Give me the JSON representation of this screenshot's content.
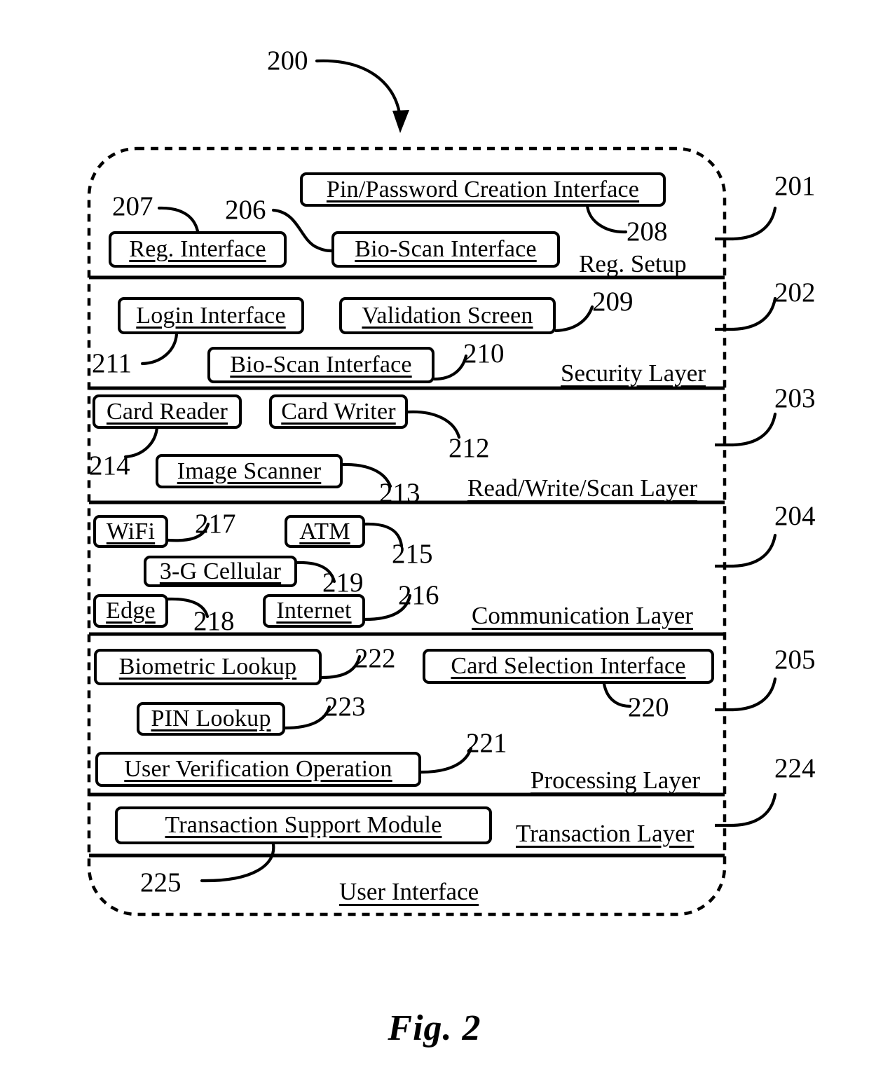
{
  "figure": {
    "caption": "Fig. 2",
    "system_ref": "200"
  },
  "diagram": {
    "type": "layered-block-diagram",
    "container_label": "User Interface",
    "container_ref": "200",
    "layers": [
      {
        "ref": "201",
        "caption": "Reg. Setup",
        "nodes": [
          {
            "ref": "208",
            "label": "Pin/Password Creation Interface"
          },
          {
            "ref": "207",
            "label": "Reg. Interface"
          },
          {
            "ref": "206",
            "label": "Bio-Scan Interface"
          }
        ]
      },
      {
        "ref": "202",
        "caption": "Security Layer",
        "nodes": [
          {
            "ref": "211",
            "label": "Login Interface"
          },
          {
            "ref": "209",
            "label": "Validation Screen"
          },
          {
            "ref": "210",
            "label": "Bio-Scan Interface"
          }
        ]
      },
      {
        "ref": "203",
        "caption": "Read/Write/Scan Layer",
        "nodes": [
          {
            "ref": "214",
            "label": "Card Reader"
          },
          {
            "ref": "212",
            "label": "Card Writer"
          },
          {
            "ref": "213",
            "label": "Image Scanner"
          }
        ]
      },
      {
        "ref": "204",
        "caption": "Communication Layer",
        "nodes": [
          {
            "ref": "217",
            "label": "WiFi"
          },
          {
            "ref": "215",
            "label": "ATM"
          },
          {
            "ref": "219",
            "label": "3-G Cellular"
          },
          {
            "ref": "218",
            "label": "Edge"
          },
          {
            "ref": "216",
            "label": "Internet"
          }
        ]
      },
      {
        "ref": "205",
        "caption": "Processing Layer",
        "nodes": [
          {
            "ref": "222",
            "label": "Biometric Lookup"
          },
          {
            "ref": "220",
            "label": "Card Selection Interface"
          },
          {
            "ref": "223",
            "label": "PIN Lookup"
          },
          {
            "ref": "221",
            "label": "User Verification Operation"
          }
        ]
      },
      {
        "ref": "224",
        "caption": "Transaction Layer",
        "nodes": [
          {
            "ref": "225",
            "label": "Transaction Support Module"
          }
        ]
      }
    ]
  },
  "nodes": {
    "pin_password_creation_interface": "Pin/Password Creation Interface",
    "reg_interface": "Reg. Interface",
    "bio_scan_interface_reg": "Bio-Scan Interface",
    "login_interface": "Login Interface",
    "validation_screen": "Validation Screen",
    "bio_scan_interface_security": "Bio-Scan Interface",
    "card_reader": "Card Reader",
    "card_writer": "Card Writer",
    "image_scanner": "Image Scanner",
    "wifi": "WiFi",
    "atm": "ATM",
    "three_g_cellular": "3-G Cellular",
    "edge": "Edge",
    "internet": "Internet",
    "biometric_lookup": "Biometric Lookup",
    "card_selection_interface": "Card Selection Interface",
    "pin_lookup": "PIN Lookup",
    "user_verification_operation": "User Verification Operation",
    "transaction_support_module": "Transaction Support Module"
  },
  "captions": {
    "reg_setup": "Reg. Setup",
    "security_layer": "Security Layer",
    "read_write_scan_layer": "Read/Write/Scan Layer",
    "communication_layer": "Communication Layer",
    "processing_layer": "Processing Layer",
    "transaction_layer": "Transaction Layer",
    "user_interface": "User Interface"
  },
  "refs": {
    "r200": "200",
    "r201": "201",
    "r202": "202",
    "r203": "203",
    "r204": "204",
    "r205": "205",
    "r206": "206",
    "r207": "207",
    "r208": "208",
    "r209": "209",
    "r210": "210",
    "r211": "211",
    "r212": "212",
    "r213": "213",
    "r214": "214",
    "r215": "215",
    "r216": "216",
    "r217": "217",
    "r218": "218",
    "r219": "219",
    "r220": "220",
    "r221": "221",
    "r222": "222",
    "r223": "223",
    "r224": "224",
    "r225": "225"
  },
  "colors": {
    "ink": "#000000",
    "paper": "#ffffff"
  }
}
